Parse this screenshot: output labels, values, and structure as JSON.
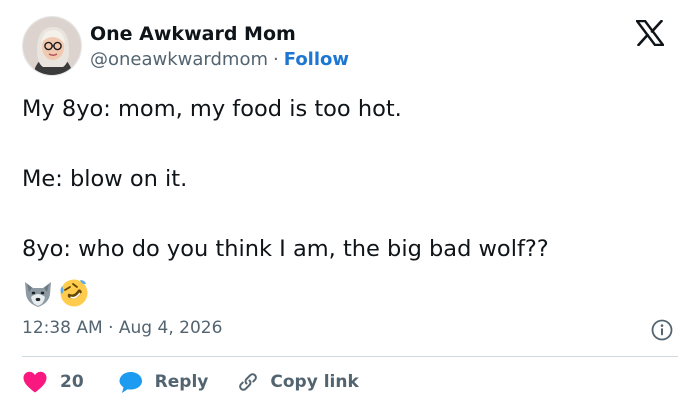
{
  "author": {
    "name": "One Awkward Mom",
    "handle": "@oneawkwardmom",
    "separator": "·",
    "follow_label": "Follow",
    "avatar_icon": "user-avatar-photo"
  },
  "brand": {
    "logo_icon": "x-logo-icon",
    "accent_color": "#1d77d2",
    "like_color": "#f91880"
  },
  "tweet": {
    "lines": [
      "My 8yo: mom, my food is too hot.",
      "Me: blow on it.",
      "8yo: who do you think I am, the big bad wolf??"
    ],
    "emoji_icons": [
      "wolf-emoji",
      "rolling-on-floor-laughing-emoji"
    ],
    "timestamp": "12:38 AM · Aug 4, 2026"
  },
  "actions": {
    "like_count": "20",
    "reply_label": "Reply",
    "copy_link_label": "Copy link",
    "info_icon": "info-icon"
  }
}
